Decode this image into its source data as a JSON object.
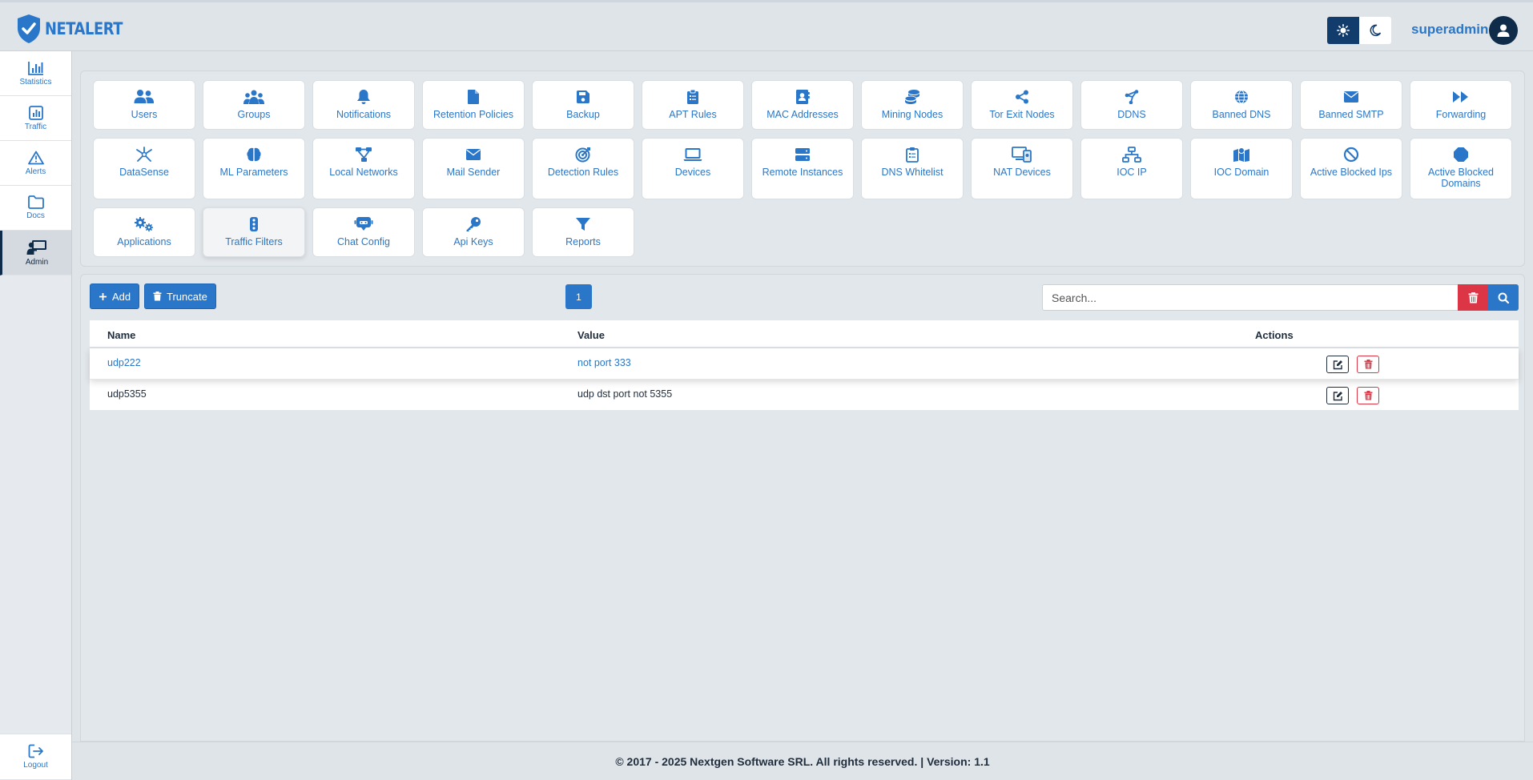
{
  "app": {
    "name": "NETALERT"
  },
  "header": {
    "username": "superadmin"
  },
  "sidebar": {
    "items": [
      {
        "label": "Statistics",
        "icon": "bar-chart-icon"
      },
      {
        "label": "Traffic",
        "icon": "chart-icon"
      },
      {
        "label": "Alerts",
        "icon": "warning-icon"
      },
      {
        "label": "Docs",
        "icon": "folder-icon"
      },
      {
        "label": "Admin",
        "icon": "presentation-icon",
        "active": true
      }
    ],
    "logout": "Logout"
  },
  "tiles": [
    {
      "label": "Users",
      "icon": "users-icon"
    },
    {
      "label": "Groups",
      "icon": "groups-icon"
    },
    {
      "label": "Notifications",
      "icon": "bell-icon"
    },
    {
      "label": "Retention Policies",
      "icon": "file-icon"
    },
    {
      "label": "Backup",
      "icon": "floppy-icon"
    },
    {
      "label": "APT Rules",
      "icon": "clipboard-icon"
    },
    {
      "label": "MAC Addresses",
      "icon": "address-book-icon"
    },
    {
      "label": "Mining Nodes",
      "icon": "coins-icon"
    },
    {
      "label": "Tor Exit Nodes",
      "icon": "share-icon"
    },
    {
      "label": "DDNS",
      "icon": "nodes-icon"
    },
    {
      "label": "Banned DNS",
      "icon": "globe-icon"
    },
    {
      "label": "Banned SMTP",
      "icon": "envelope-icon"
    },
    {
      "label": "Forwarding",
      "icon": "forward-icon"
    },
    {
      "label": "DataSense",
      "icon": "burst-icon"
    },
    {
      "label": "ML Parameters",
      "icon": "brain-icon"
    },
    {
      "label": "Local Networks",
      "icon": "network-icon"
    },
    {
      "label": "Mail Sender",
      "icon": "envelope-icon"
    },
    {
      "label": "Detection Rules",
      "icon": "target-icon"
    },
    {
      "label": "Devices",
      "icon": "laptop-icon"
    },
    {
      "label": "Remote Instances",
      "icon": "server-icon"
    },
    {
      "label": "DNS Whitelist",
      "icon": "clipboard-list-icon"
    },
    {
      "label": "NAT Devices",
      "icon": "devices-icon"
    },
    {
      "label": "IOC IP",
      "icon": "sitemap-icon"
    },
    {
      "label": "IOC Domain",
      "icon": "map-icon"
    },
    {
      "label": "Active Blocked Ips",
      "icon": "ban-icon"
    },
    {
      "label": "Active Blocked Domains",
      "icon": "octagon-icon"
    },
    {
      "label": "Applications",
      "icon": "gears-icon"
    },
    {
      "label": "Traffic Filters",
      "icon": "traffic-light-icon",
      "active": true
    },
    {
      "label": "Chat Config",
      "icon": "robot-icon"
    },
    {
      "label": "Api Keys",
      "icon": "key-icon"
    },
    {
      "label": "Reports",
      "icon": "filter-icon"
    }
  ],
  "toolbar": {
    "add_label": "Add",
    "truncate_label": "Truncate",
    "page": "1",
    "search_placeholder": "Search..."
  },
  "table": {
    "headers": {
      "name": "Name",
      "value": "Value",
      "actions": "Actions"
    },
    "rows": [
      {
        "name": "udp222",
        "value": "not port 333"
      },
      {
        "name": "udp5355",
        "value": "udp dst port not 5355"
      }
    ]
  },
  "footer": {
    "text": "© 2017 - 2025 Nextgen Software SRL. All rights reserved. | Version: 1.1"
  },
  "colors": {
    "accent": "#2a77c9",
    "dark": "#0e2b4a",
    "danger": "#dc3545",
    "background": "#dfe4e9"
  }
}
